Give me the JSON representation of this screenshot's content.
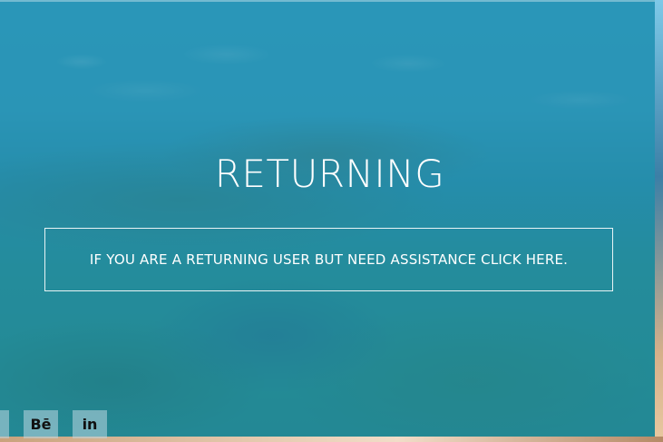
{
  "hero": {
    "title": "RETURNING",
    "assist_text": "IF YOU ARE A RETURNING USER BUT NEED ASSISTANCE CLICK HERE."
  },
  "social": {
    "behance_label": "Bē",
    "linkedin_label": "in"
  },
  "colors": {
    "overlay": "#1e8caf",
    "text": "#ffffff"
  }
}
